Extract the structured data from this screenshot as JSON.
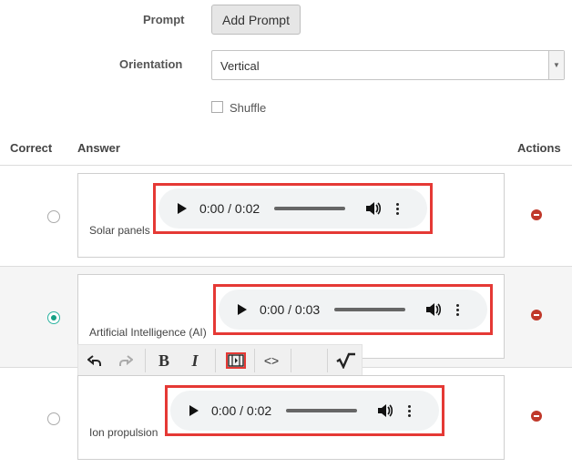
{
  "form": {
    "prompt_label": "Prompt",
    "add_prompt_button": "Add Prompt",
    "orientation_label": "Orientation",
    "orientation_value": "Vertical",
    "shuffle_label": "Shuffle"
  },
  "table": {
    "headers": {
      "correct": "Correct",
      "answer": "Answer",
      "actions": "Actions"
    },
    "rows": [
      {
        "answer": "Solar panels",
        "audio_time": "0:00 / 0:02",
        "correct": false
      },
      {
        "answer": "Artificial Intelligence (AI)",
        "audio_time": "0:00 / 0:03",
        "correct": true
      },
      {
        "answer": "Ion propulsion",
        "audio_time": "0:00 / 0:02",
        "correct": false
      }
    ]
  },
  "toolbar": {
    "buttons": [
      "undo-icon",
      "redo-icon",
      "bold-icon",
      "italic-icon",
      "media-icon",
      "code-icon",
      "math-icon"
    ]
  },
  "colors": {
    "accent": "#16a085",
    "delete": "#c0392b",
    "highlight": "#e53935"
  }
}
